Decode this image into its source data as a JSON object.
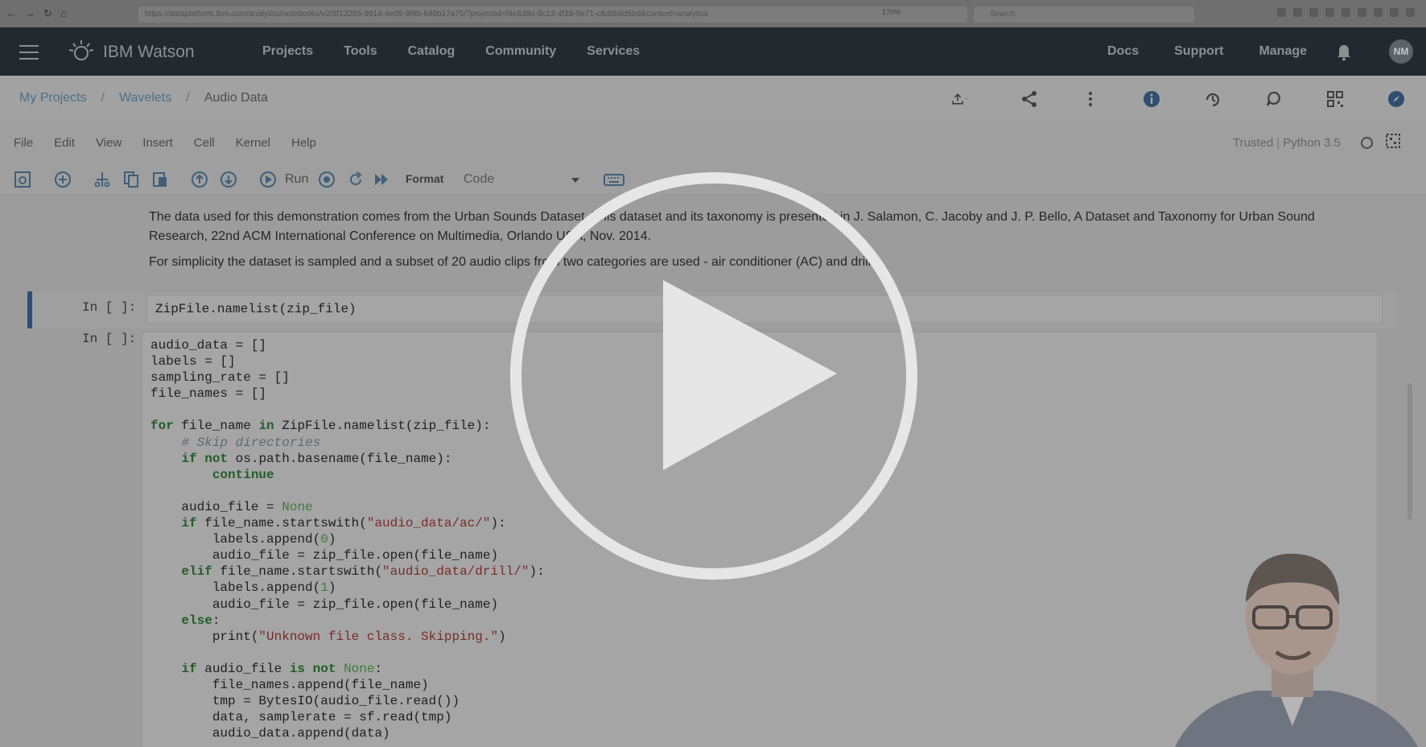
{
  "browser": {
    "url": "https://dataplatform.ibm.com/analytics/notebooks/v2/5f13285-9814-4e05-9f8b-848b17a75/?projectid=f4e8d8d-9c13-4f28-9e71-c8d5b8d5bd&context=analytics",
    "zoom": "170%",
    "search_placeholder": "Search"
  },
  "header": {
    "brand": "IBM Watson",
    "nav": [
      "Projects",
      "Tools",
      "Catalog",
      "Community",
      "Services"
    ],
    "right_nav": [
      "Docs",
      "Support",
      "Manage"
    ],
    "avatar_initials": "NM"
  },
  "breadcrumb": {
    "items": [
      "My Projects",
      "Wavelets"
    ],
    "current": "Audio Data",
    "separator": "/"
  },
  "menu": {
    "items": [
      "File",
      "Edit",
      "View",
      "Insert",
      "Cell",
      "Kernel",
      "Help"
    ],
    "trusted": "Trusted",
    "kernel_name": "Python 3.5"
  },
  "toolbar": {
    "run_label": "Run",
    "format_label": "Format",
    "cell_type": "Code"
  },
  "notebook": {
    "markdown": [
      "The data used for this demonstration comes from the Urban Sounds Dataset. This dataset and its taxonomy is presented in J. Salamon, C. Jacoby and J. P. Bello, A Dataset and Taxonomy for Urban Sound Research, 22nd ACM International Conference on Multimedia, Orlando USA, Nov. 2014.",
      "For simplicity the dataset is sampled and a subset of 20 audio clips from two categories are used - air conditioner (AC) and drill."
    ],
    "cell1": {
      "prompt": "In [ ]:",
      "code": "ZipFile.namelist(zip_file)"
    },
    "cell2": {
      "prompt": "In [ ]:",
      "lines": [
        "audio_data = []",
        "labels = []",
        "sampling_rate = []",
        "file_names = []",
        "",
        "for file_name in ZipFile.namelist(zip_file):",
        "    # Skip directories",
        "    if not os.path.basename(file_name):",
        "        continue",
        "",
        "    audio_file = None",
        "    if file_name.startswith(\"audio_data/ac/\"):",
        "        labels.append(0)",
        "        audio_file = zip_file.open(file_name)",
        "    elif file_name.startswith(\"audio_data/drill/\"):",
        "        labels.append(1)",
        "        audio_file = zip_file.open(file_name)",
        "    else:",
        "        print(\"Unknown file class. Skipping.\")",
        "",
        "    if audio_file is not None:",
        "        file_names.append(file_name)",
        "        tmp = BytesIO(audio_file.read())",
        "        data, samplerate = sf.read(tmp)",
        "        audio_data.append(data)"
      ]
    }
  },
  "colors": {
    "top_nav_bg": "#232a2f",
    "active_cell_border": "#2e4d78",
    "link": "#4d6f88",
    "play_overlay": "#e6e6e6"
  },
  "icons": [
    "hamburger-icon",
    "watson-logo-icon",
    "bell-icon",
    "upload-icon",
    "share-icon",
    "more-vertical-icon",
    "info-icon",
    "history-icon",
    "comment-icon",
    "grid-icon",
    "compass-icon",
    "play-icon"
  ]
}
